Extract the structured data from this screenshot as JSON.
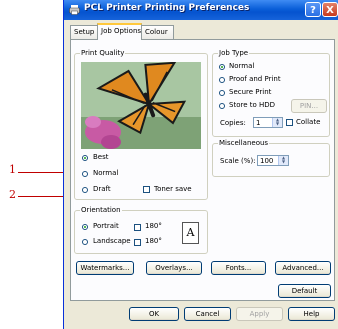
{
  "window": {
    "title": "PCL Printer Printing Preferences",
    "help_glyph": "?",
    "close_glyph": "X"
  },
  "tabs": [
    {
      "label": "Setup"
    },
    {
      "label": "Job Options"
    },
    {
      "label": "Colour"
    }
  ],
  "print_quality": {
    "title": "Print Quality",
    "options": [
      {
        "label": "Best",
        "selected": true
      },
      {
        "label": "Normal",
        "selected": false
      },
      {
        "label": "Draft",
        "selected": false
      }
    ],
    "toner_save": {
      "label": "Toner save",
      "checked": false
    }
  },
  "orientation": {
    "title": "Orientation",
    "portrait": {
      "label": "Portrait",
      "selected": true
    },
    "landscape": {
      "label": "Landscape",
      "selected": false
    },
    "rotate_label": "180°",
    "preview_letter": "A"
  },
  "job_type": {
    "title": "Job Type",
    "options": [
      {
        "label": "Normal",
        "selected": true
      },
      {
        "label": "Proof and Print",
        "selected": false
      },
      {
        "label": "Secure Print",
        "selected": false
      },
      {
        "label": "Store to HDD",
        "selected": false
      }
    ],
    "pin_label": "PIN...",
    "copies_label": "Copies:",
    "copies_value": "1",
    "collate_label": "Collate"
  },
  "miscellaneous": {
    "title": "Miscellaneous",
    "scale_label": "Scale (%):",
    "scale_value": "100"
  },
  "buttons": {
    "watermarks": "Watermarks...",
    "overlays": "Overlays...",
    "fonts": "Fonts...",
    "advanced": "Advanced...",
    "default": "Default"
  },
  "dialog_buttons": {
    "ok": "OK",
    "cancel": "Cancel",
    "apply": "Apply",
    "help": "Help"
  },
  "callouts": [
    {
      "label": "1"
    },
    {
      "label": "2"
    }
  ],
  "colors": {
    "title_bar": "#0a5fd8",
    "callout": "#c00000",
    "dialog_bg": "#ece9d8"
  }
}
